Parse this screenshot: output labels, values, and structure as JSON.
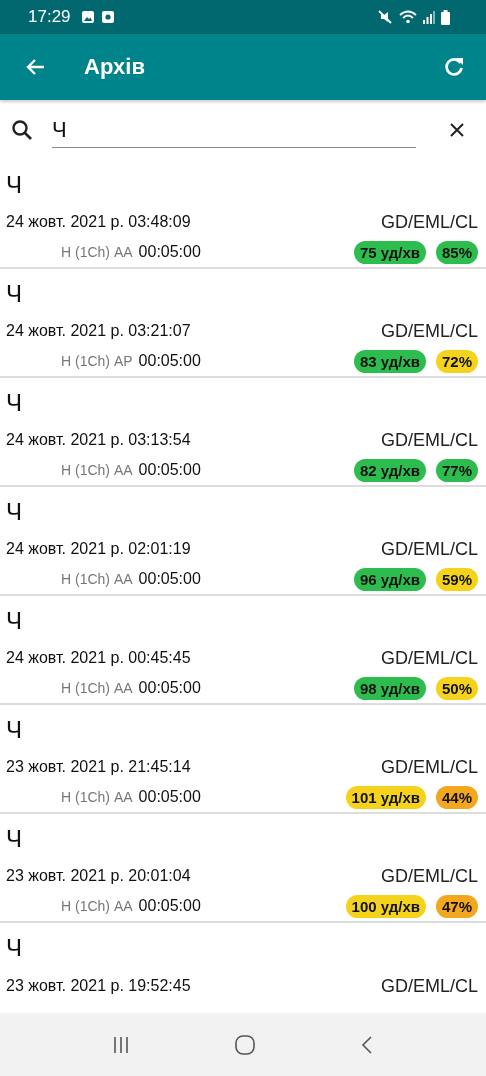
{
  "status_bar": {
    "time": "17:29"
  },
  "app_bar": {
    "title": "Архів"
  },
  "search": {
    "value": "Ч"
  },
  "records": [
    {
      "name": "Ч",
      "datetime": "24 жовт. 2021 р. 03:48:09",
      "mode": "GD/EML/CL",
      "channel": "Н (1Ch) АА",
      "duration": "00:05:00",
      "badges": [
        {
          "text": "75 уд/хв",
          "color": "#2dbd4e"
        },
        {
          "text": "85%",
          "color": "#2dbd4e"
        }
      ]
    },
    {
      "name": "Ч",
      "datetime": "24 жовт. 2021 р. 03:21:07",
      "mode": "GD/EML/CL",
      "channel": "Н (1Ch) АР",
      "duration": "00:05:00",
      "badges": [
        {
          "text": "83 уд/хв",
          "color": "#2dbd4e"
        },
        {
          "text": "72%",
          "color": "#f5d31c"
        }
      ]
    },
    {
      "name": "Ч",
      "datetime": "24 жовт. 2021 р. 03:13:54",
      "mode": "GD/EML/CL",
      "channel": "Н (1Ch) АА",
      "duration": "00:05:00",
      "badges": [
        {
          "text": "82 уд/хв",
          "color": "#2dbd4e"
        },
        {
          "text": "77%",
          "color": "#2dbd4e"
        }
      ]
    },
    {
      "name": "Ч",
      "datetime": "24 жовт. 2021 р. 02:01:19",
      "mode": "GD/EML/CL",
      "channel": "Н (1Ch) АА",
      "duration": "00:05:00",
      "badges": [
        {
          "text": "96 уд/хв",
          "color": "#2dbd4e"
        },
        {
          "text": "59%",
          "color": "#f5d31c"
        }
      ]
    },
    {
      "name": "Ч",
      "datetime": "24 жовт. 2021 р. 00:45:45",
      "mode": "GD/EML/CL",
      "channel": "Н (1Ch) АА",
      "duration": "00:05:00",
      "badges": [
        {
          "text": "98 уд/хв",
          "color": "#2dbd4e"
        },
        {
          "text": "50%",
          "color": "#f5d31c"
        }
      ]
    },
    {
      "name": "Ч",
      "datetime": "23 жовт. 2021 р. 21:45:14",
      "mode": "GD/EML/CL",
      "channel": "Н (1Ch) АА",
      "duration": "00:05:00",
      "badges": [
        {
          "text": "101 уд/хв",
          "color": "#f5d31c"
        },
        {
          "text": "44%",
          "color": "#f2a71e"
        }
      ]
    },
    {
      "name": "Ч",
      "datetime": "23 жовт. 2021 р. 20:01:04",
      "mode": "GD/EML/CL",
      "channel": "Н (1Ch) АА",
      "duration": "00:05:00",
      "badges": [
        {
          "text": "100 уд/хв",
          "color": "#f5d31c"
        },
        {
          "text": "47%",
          "color": "#f2a71e"
        }
      ]
    },
    {
      "name": "Ч",
      "datetime": "23 жовт. 2021 р. 19:52:45",
      "mode": "GD/EML/CL"
    }
  ]
}
